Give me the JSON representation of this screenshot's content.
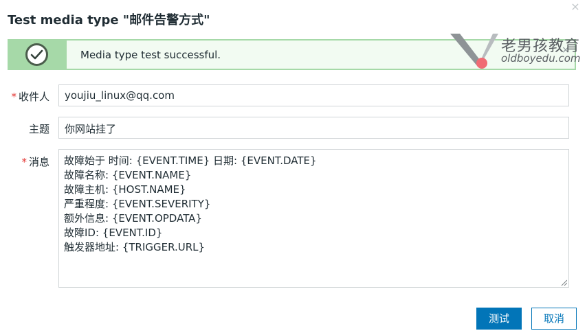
{
  "dialog": {
    "title": "Test media type \"邮件告警方式\"",
    "close_icon": "×"
  },
  "message": {
    "text": "Media type test successful.",
    "icon": "check-circle-icon",
    "close_icon": "×",
    "color": "#a6d9a8"
  },
  "form": {
    "recipient": {
      "label": "收件人",
      "required_mark": "*",
      "value": "youjiu_linux@qq.com"
    },
    "subject": {
      "label": "主题",
      "value": "你网站挂了"
    },
    "message": {
      "label": "消息",
      "required_mark": "*",
      "lines": [
        "故障始于 时间: {EVENT.TIME} 日期: {EVENT.DATE}",
        "故障名称: {EVENT.NAME}",
        "故障主机: {HOST.NAME}",
        "严重程度: {EVENT.SEVERITY}",
        "额外信息: {EVENT.OPDATA}",
        "故障ID: {EVENT.ID}",
        "触发器地址: {TRIGGER.URL}"
      ]
    }
  },
  "buttons": {
    "test": "测试",
    "cancel": "取消",
    "primary_color": "#0275b8"
  },
  "watermark": {
    "cn": "老男孩教育",
    "en": "oldboyedu.com"
  }
}
